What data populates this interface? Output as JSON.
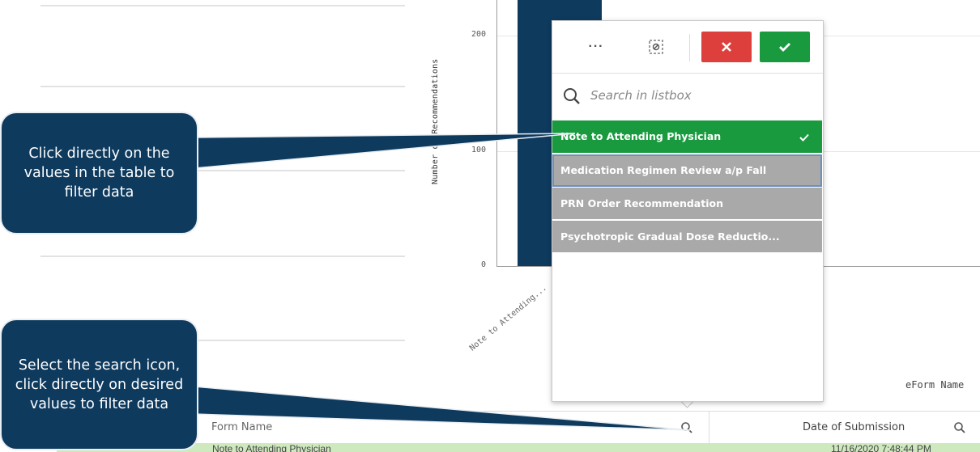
{
  "chart": {
    "y_axis_title": "Number of Recommendations",
    "y_ticks": [
      "200",
      "100",
      "0"
    ],
    "x_category": "Note to Attending...",
    "eform_label": "eForm Name"
  },
  "listbox": {
    "more_icon": "more-options-icon",
    "clear_icon": "clear-selection-icon",
    "cancel_icon": "close-icon",
    "confirm_icon": "checkmark-icon",
    "search_placeholder": "Search in listbox",
    "items": [
      {
        "label": "Note to Attending Physician",
        "state": "selected"
      },
      {
        "label": "Medication Regimen Review a/p Fall",
        "state": "alternative"
      },
      {
        "label": "PRN Order Recommendation",
        "state": "alternative"
      },
      {
        "label": "Psychotropic Gradual Dose Reductio...",
        "state": "alternative"
      }
    ]
  },
  "table": {
    "columns": [
      {
        "label": "Form Name"
      },
      {
        "label": "Date of Submission"
      }
    ],
    "row": {
      "form_name": "Note to Attending Physician",
      "date": "11/16/2020 7:48:44 PM"
    }
  },
  "callouts": {
    "top": "Click directly on the values in the table to filter data",
    "bottom": "Select the search icon, click directly on desired values to filter data"
  },
  "colors": {
    "navy": "#0e3a5e",
    "selected_green": "#1a9a3f",
    "alternative_gray": "#a9a9a9",
    "cancel_red": "#dc3f3c"
  }
}
